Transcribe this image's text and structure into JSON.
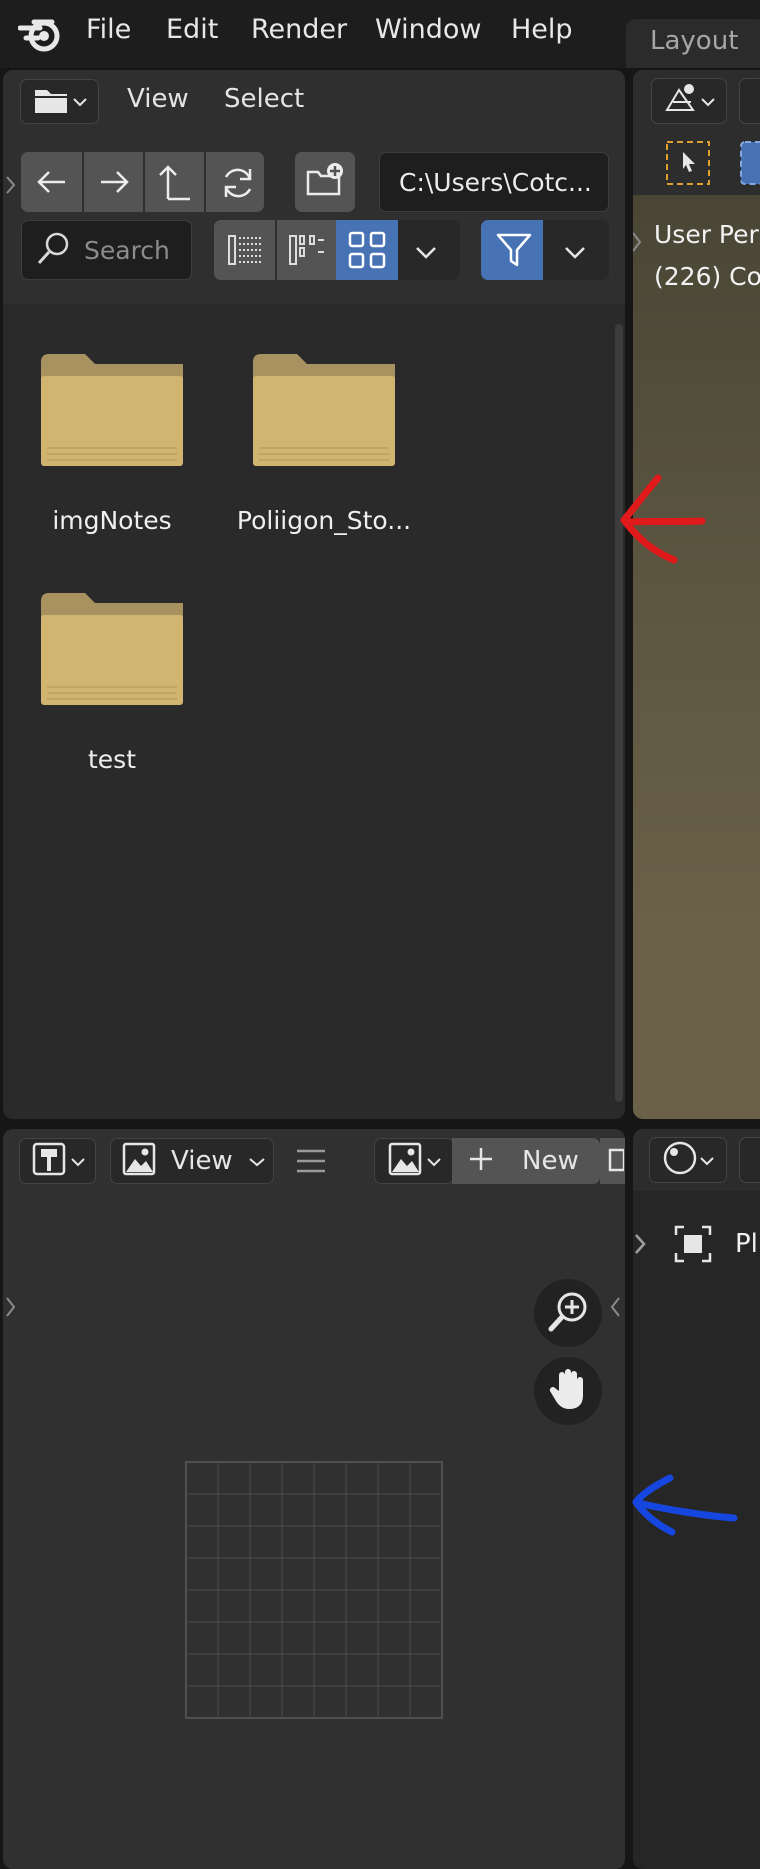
{
  "menubar": {
    "items": [
      "File",
      "Edit",
      "Render",
      "Window",
      "Help"
    ],
    "workspace_tab": "Layout"
  },
  "file_browser": {
    "header": {
      "view_label": "View",
      "select_label": "Select",
      "path": "C:\\Users\\Cotc...",
      "search_placeholder": "Search"
    },
    "display_modes": [
      "vertical-list-icon",
      "horizontal-list-icon",
      "thumbnails-icon"
    ],
    "active_display_mode": "thumbnails-icon",
    "filter_enabled": true,
    "folders": [
      {
        "name": "imgNotes"
      },
      {
        "name": "Poliigon_Sto..."
      },
      {
        "name": "test"
      }
    ]
  },
  "image_editor": {
    "header": {
      "view_label": "View",
      "new_label": "New"
    },
    "navigation": [
      "zoom-in-icon",
      "pan-hand-icon"
    ]
  },
  "viewport": {
    "overlay_line1": "User Per",
    "overlay_line2": "(226) Co"
  },
  "outliner": {
    "first_item_label": "Pl"
  },
  "annotations": [
    {
      "color": "#e01a1a",
      "name": "red-arrow"
    },
    {
      "color": "#1646e0",
      "name": "blue-arrow"
    }
  ],
  "colors": {
    "accent_blue": "#4772b3",
    "folder_body": "#d1b46f",
    "folder_tab": "#a89260",
    "select_box_orange": "#e0a030"
  }
}
